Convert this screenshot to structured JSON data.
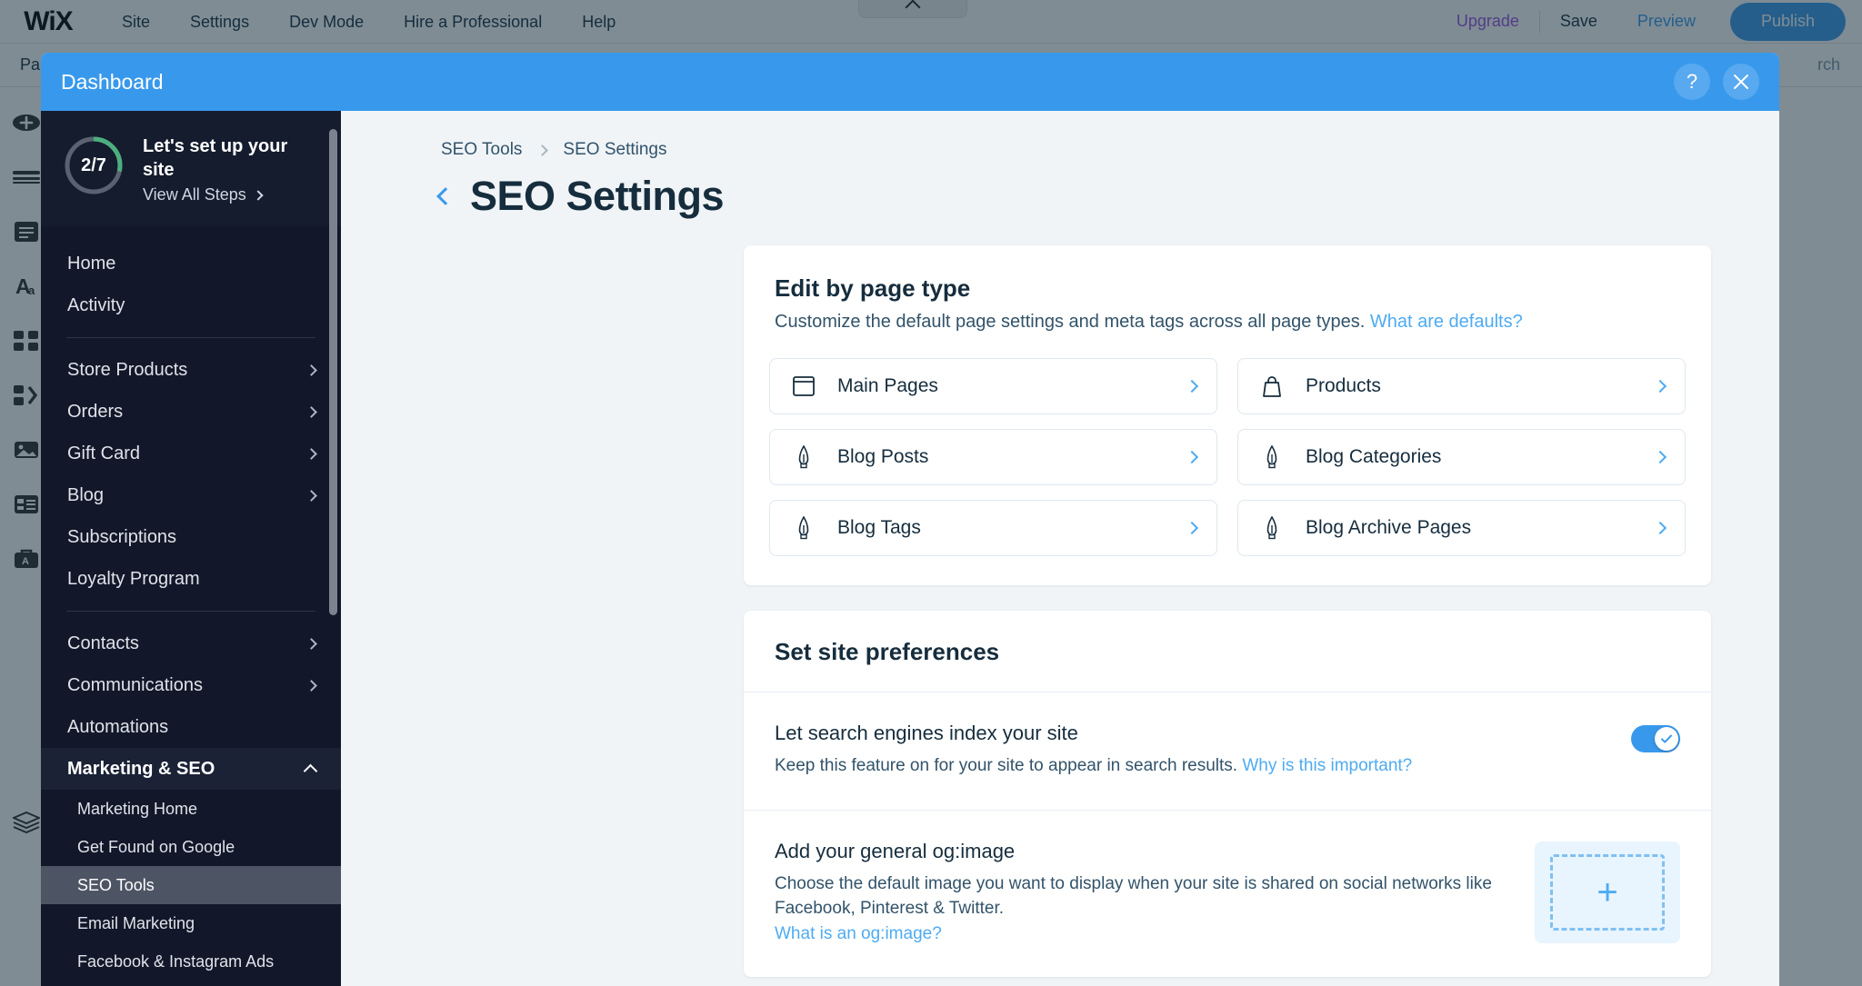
{
  "editor": {
    "logo": "WiX",
    "menu": [
      "Site",
      "Settings",
      "Dev Mode",
      "Hire a Professional",
      "Help"
    ],
    "upgrade": "Upgrade",
    "save": "Save",
    "preview": "Preview",
    "publish": "Publish",
    "pages_label": "Pa",
    "search_label": "rch",
    "colors": {
      "publish_bg": "#3899ec",
      "upgrade": "#9b51e0",
      "preview": "#3899ec"
    },
    "rail_icons": [
      "add-icon",
      "menus-icon",
      "pages-icon",
      "text-icon",
      "apps-icon",
      "my-designs-icon",
      "media-icon",
      "blog-icon",
      "business-icon",
      "layers-icon"
    ],
    "tab_pill_icon": "chevron-up-icon"
  },
  "modal": {
    "title": "Dashboard",
    "help_icon": "question-mark-icon",
    "close_icon": "close-icon"
  },
  "sidebar": {
    "setup": {
      "progress_text": "2/7",
      "progress_done": 2,
      "progress_total": 7,
      "heading": "Let's set up your site",
      "link": "View All Steps",
      "link_icon": "chevron-right-icon",
      "ring_color": "#4caf7d",
      "ring_track": "#5a6272"
    },
    "items": [
      {
        "label": "Home",
        "type": "item"
      },
      {
        "label": "Activity",
        "type": "item"
      },
      {
        "type": "divider"
      },
      {
        "label": "Store Products",
        "type": "item",
        "icon": "chevron-right-icon"
      },
      {
        "label": "Orders",
        "type": "item",
        "icon": "chevron-right-icon"
      },
      {
        "label": "Gift Card",
        "type": "item",
        "icon": "chevron-right-icon"
      },
      {
        "label": "Blog",
        "type": "item",
        "icon": "chevron-right-icon"
      },
      {
        "label": "Subscriptions",
        "type": "item"
      },
      {
        "label": "Loyalty Program",
        "type": "item"
      },
      {
        "type": "divider"
      },
      {
        "label": "Contacts",
        "type": "item",
        "icon": "chevron-right-icon"
      },
      {
        "label": "Communications",
        "type": "item",
        "icon": "chevron-right-icon"
      },
      {
        "label": "Automations",
        "type": "item"
      },
      {
        "label": "Marketing & SEO",
        "type": "group",
        "icon": "chevron-up-icon"
      },
      {
        "label": "Marketing Home",
        "type": "sub"
      },
      {
        "label": "Get Found on Google",
        "type": "sub"
      },
      {
        "label": "SEO Tools",
        "type": "sub",
        "active": true
      },
      {
        "label": "Email Marketing",
        "type": "sub"
      },
      {
        "label": "Facebook & Instagram Ads",
        "type": "sub"
      }
    ]
  },
  "breadcrumb": {
    "items": [
      "SEO Tools",
      "SEO Settings"
    ],
    "separator_icon": "chevron-right-icon"
  },
  "page": {
    "back_icon": "chevron-left-icon",
    "title": "SEO Settings"
  },
  "edit_by_page_type": {
    "heading": "Edit by page type",
    "description": "Customize the default page settings and meta tags across all page types.",
    "link": "What are defaults?",
    "tiles": [
      {
        "label": "Main Pages",
        "icon": "window-icon",
        "chevron": "chevron-right-icon"
      },
      {
        "label": "Products",
        "icon": "bag-icon",
        "chevron": "chevron-right-icon"
      },
      {
        "label": "Blog Posts",
        "icon": "pen-nib-icon",
        "chevron": "chevron-right-icon"
      },
      {
        "label": "Blog Categories",
        "icon": "pen-nib-icon",
        "chevron": "chevron-right-icon"
      },
      {
        "label": "Blog Tags",
        "icon": "pen-nib-icon",
        "chevron": "chevron-right-icon"
      },
      {
        "label": "Blog Archive Pages",
        "icon": "pen-nib-icon",
        "chevron": "chevron-right-icon"
      }
    ]
  },
  "site_preferences": {
    "heading": "Set site preferences",
    "index": {
      "title": "Let search engines index your site",
      "description": "Keep this feature on for your site to appear in search results.",
      "link": "Why is this important?",
      "toggle_on": true,
      "toggle_icon": "check-icon"
    },
    "ogimage": {
      "title": "Add your general og:image",
      "description": "Choose the default image you want to display when your site is shared on social networks like Facebook, Pinterest & Twitter.",
      "link": "What is an og:image?",
      "upload_icon": "plus-icon"
    }
  }
}
